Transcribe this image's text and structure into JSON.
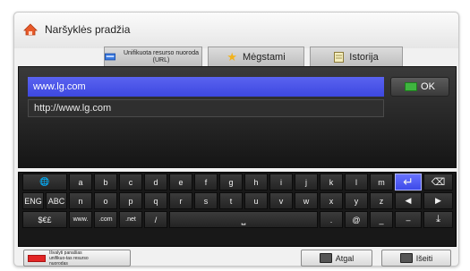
{
  "header": {
    "title": "Naršyklės pradžia",
    "icon": "home-icon"
  },
  "tabs": [
    {
      "label": "Unifikuota resurso nuoroda (URL)",
      "icon": "url-icon"
    },
    {
      "label": "Mėgstami",
      "icon": "star-icon"
    },
    {
      "label": "Istorija",
      "icon": "note-icon"
    }
  ],
  "url_input": {
    "value": "www.lg.com"
  },
  "suggestions": [
    "http://www.lg.com"
  ],
  "ok_button": {
    "label": "OK"
  },
  "keyboard": {
    "row1": [
      "🌐",
      "a",
      "b",
      "c",
      "d",
      "e",
      "f",
      "g",
      "h",
      "i",
      "j",
      "k",
      "l",
      "m",
      "↵",
      "⌫"
    ],
    "row2": [
      "ENG",
      "ABC",
      "n",
      "o",
      "p",
      "q",
      "r",
      "s",
      "t",
      "u",
      "v",
      "w",
      "x",
      "y",
      "z",
      "◀",
      "▶"
    ],
    "row3": [
      "$€£",
      "www.",
      ".com",
      ".net",
      "/",
      "⎵",
      ".",
      "@",
      "_",
      "–",
      "⤓"
    ]
  },
  "footer": {
    "clear_label": "Išvalyti panašias unifikuo-tas resurso nuorodas",
    "back_label": "Atgal",
    "exit_label": "Išeiti"
  },
  "colors": {
    "accent": "#4a55ec",
    "ok_green": "#3fb53f",
    "clear_red": "#e32525"
  }
}
